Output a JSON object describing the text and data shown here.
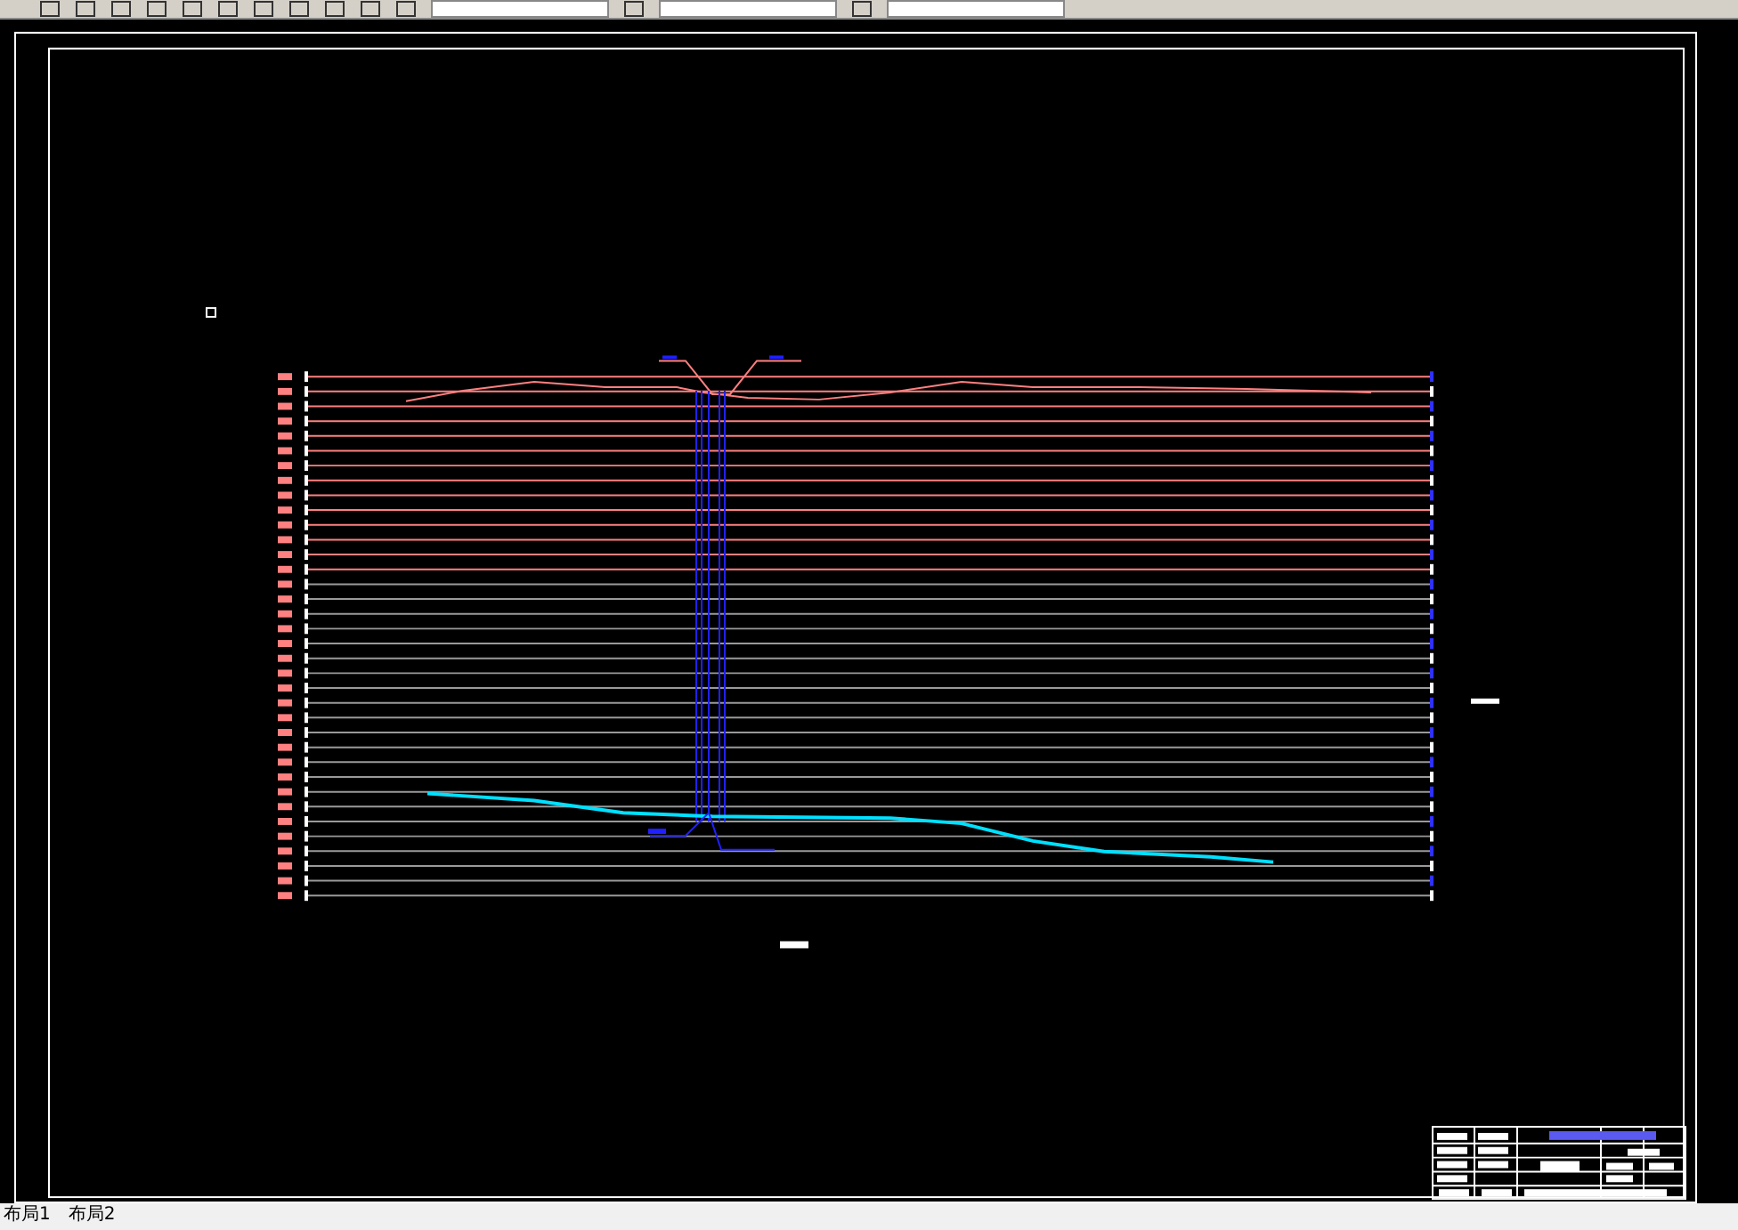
{
  "toolbar": {
    "items": [
      {
        "kind": "icon"
      },
      {
        "kind": "icon"
      },
      {
        "kind": "icon"
      },
      {
        "kind": "icon"
      },
      {
        "kind": "icon"
      },
      {
        "kind": "icon"
      },
      {
        "kind": "icon"
      },
      {
        "kind": "icon"
      },
      {
        "kind": "icon"
      },
      {
        "kind": "icon"
      },
      {
        "kind": "icon"
      },
      {
        "kind": "field"
      },
      {
        "kind": "icon"
      },
      {
        "kind": "field"
      },
      {
        "kind": "icon"
      },
      {
        "kind": "field"
      }
    ]
  },
  "layout_tabs": [
    {
      "label": "布局1",
      "selected": false
    },
    {
      "label": "布局2",
      "selected": false
    }
  ]
}
